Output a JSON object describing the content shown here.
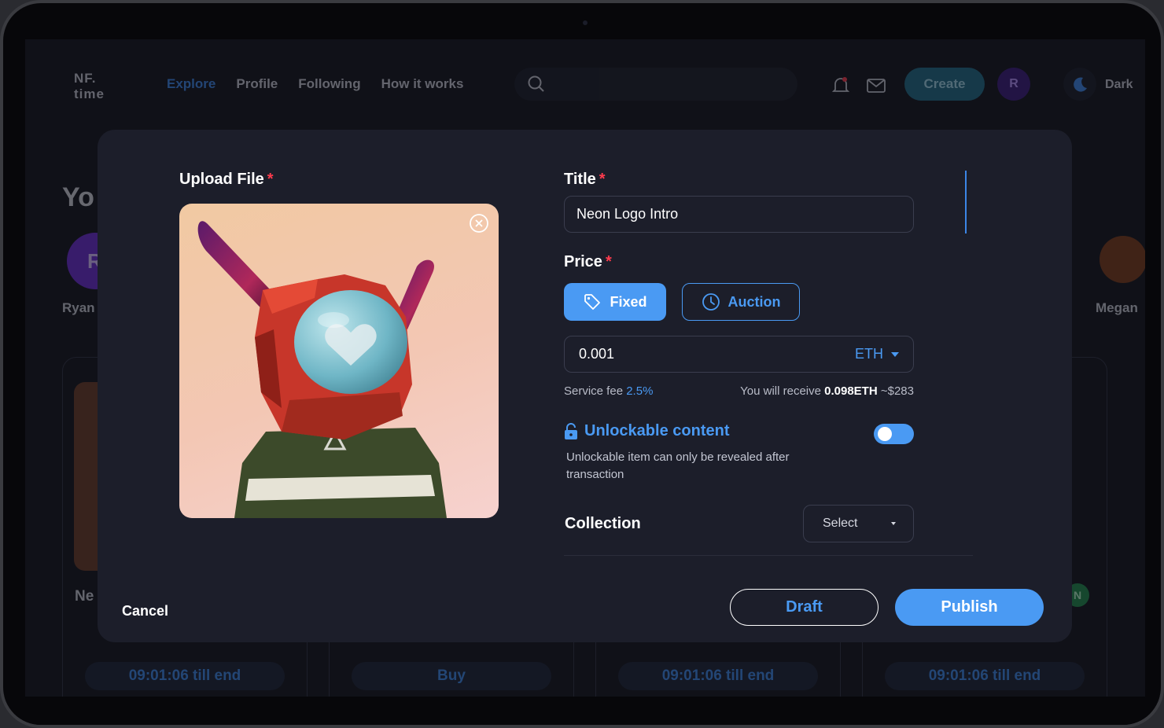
{
  "app": {
    "logo_line1": "NF.",
    "logo_line2": "time",
    "nav": [
      "Explore",
      "Profile",
      "Following",
      "How it works"
    ],
    "create_label": "Create",
    "user_initial": "R",
    "theme_label": "Dark"
  },
  "background": {
    "heading": "Yo",
    "left_avatar_initial": "R",
    "left_creator": "Ryan",
    "right_creator": "Megan",
    "card_title": "Ne",
    "badge": "N",
    "timers": [
      "09:01:06 till  end",
      "Buy",
      "09:01:06 till  end",
      "09:01:06 till  end"
    ]
  },
  "modal": {
    "upload_label": "Upload File",
    "required_mark": "*",
    "title_label": "Title",
    "title_value": "Neon Logo Intro",
    "price_label": "Price",
    "fixed_label": "Fixed",
    "auction_label": "Auction",
    "price_value": "0.001",
    "currency": "ETH",
    "service_fee_label": "Service fee",
    "service_fee_value": "2.5%",
    "receive_label": "You will receive",
    "receive_eth": "0.098ETH",
    "receive_usd": "~$283",
    "unlock_title": "Unlockable content",
    "unlock_desc": "Unlockable item can only be revealed after transaction",
    "unlock_enabled": true,
    "collection_label": "Collection",
    "collection_select": "Select",
    "cancel_label": "Cancel",
    "draft_label": "Draft",
    "publish_label": "Publish",
    "accent_color": "#4a9af3"
  }
}
